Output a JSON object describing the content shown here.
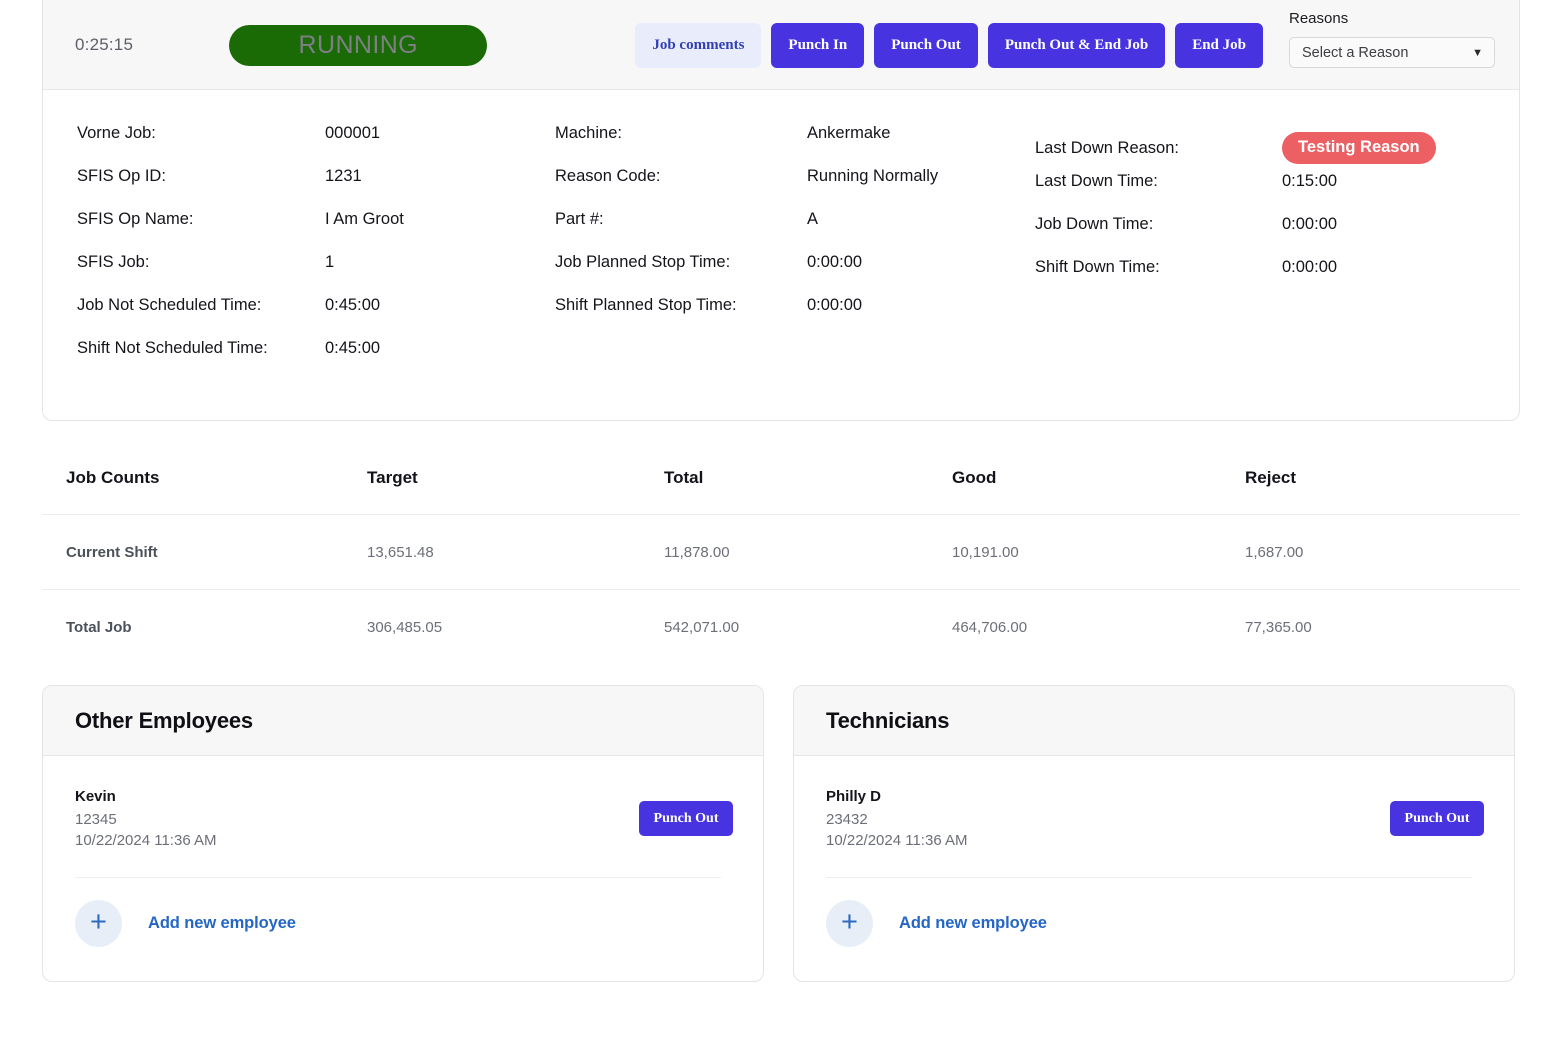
{
  "header": {
    "timer": "0:25:15",
    "status": "RUNNING",
    "status_color": "#1a6b06",
    "buttons": [
      {
        "label": "Job comments",
        "style": "soft"
      },
      {
        "label": "Punch In",
        "style": "primary"
      },
      {
        "label": "Punch Out",
        "style": "primary"
      },
      {
        "label": "Punch Out & End Job",
        "style": "primary"
      },
      {
        "label": "End Job",
        "style": "primary"
      }
    ],
    "reasons": {
      "label": "Reasons",
      "selected": "Select a Reason"
    }
  },
  "info": {
    "column_1": [
      {
        "label": "Vorne Job:",
        "value": "000001"
      },
      {
        "label": "SFIS Op ID:",
        "value": "1231"
      },
      {
        "label": "SFIS Op Name:",
        "value": "I Am Groot"
      },
      {
        "label": "SFIS Job:",
        "value": "1"
      },
      {
        "label": "Job Not Scheduled Time:",
        "value": "0:45:00"
      },
      {
        "label": "Shift Not Scheduled Time:",
        "value": "0:45:00"
      }
    ],
    "column_2": [
      {
        "label": "Machine:",
        "value": "Ankermake"
      },
      {
        "label": "Reason Code:",
        "value": "Running Normally"
      },
      {
        "label": "Part #:",
        "value": "A"
      },
      {
        "label": "Job Planned Stop Time:",
        "value": "0:00:00"
      },
      {
        "label": "Shift Planned Stop Time:",
        "value": "0:00:00"
      }
    ],
    "column_3": {
      "badge_row": {
        "label": "Last Down Reason:",
        "value": "Testing Reason",
        "color": "#ec5f63"
      },
      "rows": [
        {
          "label": "Last Down Time:",
          "value": "0:15:00"
        },
        {
          "label": "Job Down Time:",
          "value": "0:00:00"
        },
        {
          "label": "Shift Down Time:",
          "value": "0:00:00"
        }
      ]
    }
  },
  "counts": {
    "headers": [
      "Job Counts",
      "Target",
      "Total",
      "Good",
      "Reject"
    ],
    "rows": [
      {
        "label": "Current Shift",
        "target": "13,651.48",
        "total": "11,878.00",
        "good": "10,191.00",
        "reject": "1,687.00"
      },
      {
        "label": "Total Job",
        "target": "306,485.05",
        "total": "542,071.00",
        "good": "464,706.00",
        "reject": "77,365.00"
      }
    ]
  },
  "employees_card": {
    "title": "Other Employees",
    "person": {
      "name": "Kevin",
      "id": "12345",
      "time": "10/22/2024 11:36 AM",
      "punch_out_label": "Punch Out"
    },
    "add_label": "Add new employee"
  },
  "technicians_card": {
    "title": "Technicians",
    "person": {
      "name": "Philly D",
      "id": "23432",
      "time": "10/22/2024 11:36 AM",
      "punch_out_label": "Punch Out"
    },
    "add_label": "Add new employee"
  }
}
